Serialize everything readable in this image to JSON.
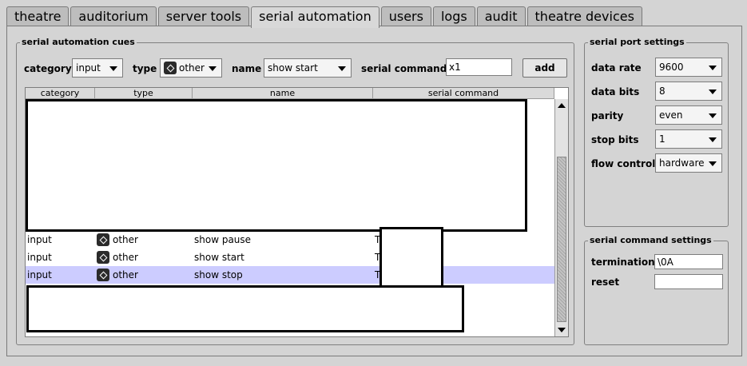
{
  "tabs": [
    {
      "label": "theatre",
      "active": false
    },
    {
      "label": "auditorium",
      "active": false
    },
    {
      "label": "server tools",
      "active": false
    },
    {
      "label": "serial automation",
      "active": true
    },
    {
      "label": "users",
      "active": false
    },
    {
      "label": "logs",
      "active": false
    },
    {
      "label": "audit",
      "active": false
    },
    {
      "label": "theatre devices",
      "active": false
    }
  ],
  "cues": {
    "legend": "serial automation cues",
    "category_label": "category",
    "category_value": "input",
    "type_label": "type",
    "type_value": "other",
    "type_icon": "other-device-icon",
    "name_label": "name",
    "name_value": "show start",
    "command_label": "serial command",
    "command_value": "x1",
    "add_label": "add",
    "columns": [
      "category",
      "type",
      "name",
      "serial command"
    ],
    "rows": [
      {
        "category": "input",
        "type": "other",
        "icon": "other-device-icon",
        "name": "show pause",
        "command": "T",
        "selected": false
      },
      {
        "category": "input",
        "type": "other",
        "icon": "other-device-icon",
        "name": "show start",
        "command": "T",
        "selected": false
      },
      {
        "category": "input",
        "type": "other",
        "icon": "other-device-icon",
        "name": "show stop",
        "command": "T",
        "selected": true
      }
    ]
  },
  "port_settings": {
    "legend": "serial port settings",
    "data_rate_label": "data rate",
    "data_rate_value": "9600",
    "data_bits_label": "data bits",
    "data_bits_value": "8",
    "parity_label": "parity",
    "parity_value": "even",
    "stop_bits_label": "stop bits",
    "stop_bits_value": "1",
    "flow_control_label": "flow control",
    "flow_control_value": "hardware"
  },
  "command_settings": {
    "legend": "serial command settings",
    "termination_label": "termination",
    "termination_value": "\\0A",
    "reset_label": "reset",
    "reset_value": ""
  },
  "colors": {
    "selection": "#ccccff",
    "background": "#d4d4d4"
  }
}
